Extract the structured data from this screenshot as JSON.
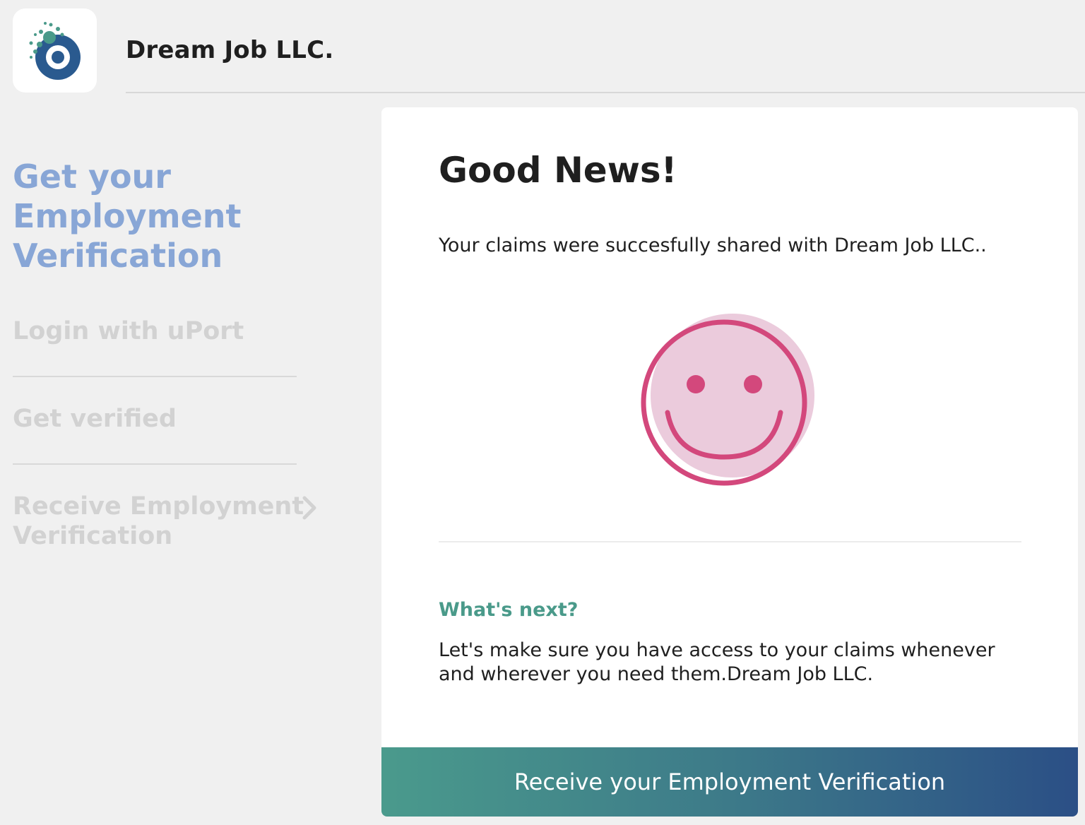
{
  "header": {
    "logo_icon": "uport-logo-icon",
    "app_title": "Dream Job LLC."
  },
  "sidebar": {
    "heading": "Get your Employment Verification",
    "steps": [
      {
        "label": "Login with uPort"
      },
      {
        "label": "Get verified"
      },
      {
        "label": "Receive Employment Verification",
        "icon": "chevron-right-icon"
      }
    ]
  },
  "card": {
    "title": "Good News!",
    "message": "Your claims were succesfully shared with Dream Job LLC..",
    "illustration_icon": "smiley-face-icon",
    "next_heading": "What's next?",
    "next_text": "Let's make sure you have access to your claims whenever and wherever you need them.Dream Job LLC.",
    "cta_label": "Receive your Employment Verification"
  },
  "colors": {
    "background": "#f0f0f0",
    "sidebar_heading": "#88a6d6",
    "inactive_step": "#d2d2d2",
    "next_heading": "#4a9a8a",
    "smiley_stroke": "#d3487c",
    "smiley_fill": "#ebcbdc",
    "cta_gradient_start": "#4a9a8c",
    "cta_gradient_end": "#2b4f86"
  }
}
